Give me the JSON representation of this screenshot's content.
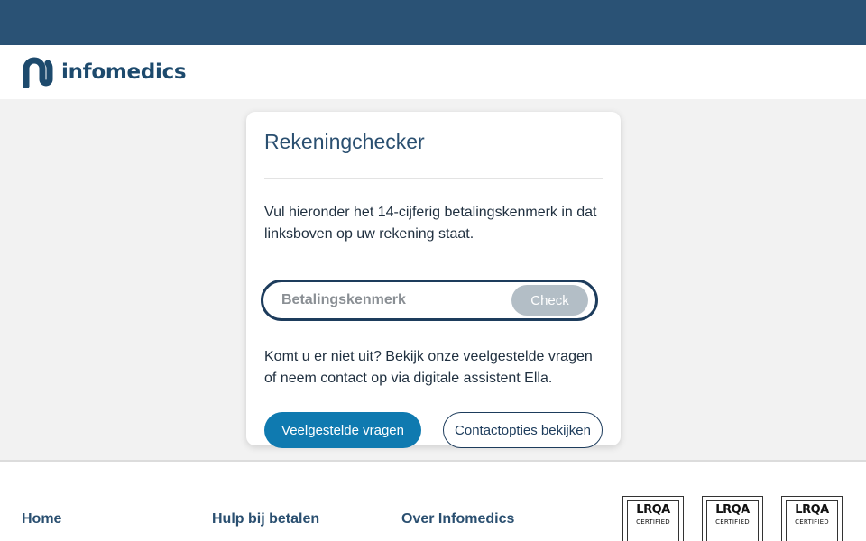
{
  "brand": {
    "name": "infomedics",
    "color": "#1d4a6d"
  },
  "colors": {
    "top_bar": "#2a5275",
    "primary": "#0f7ab0",
    "dark": "#1d3c5c",
    "check_disabled": "#b3bec6"
  },
  "card": {
    "title": "Rekeningchecker",
    "intro": "Vul hieronder het 14-cijferig betalingskenmerk in dat linksboven op uw rekening staat.",
    "search": {
      "placeholder": "Betalingskenmerk",
      "value": "",
      "button_label": "Check"
    },
    "help_text": "Komt u er niet uit? Bekijk onze veelgestelde vragen of neem contact op via digitale assistent Ella.",
    "faq_button": "Veelgestelde vragen",
    "contact_button": "Contactopties bekijken"
  },
  "footer": {
    "links": [
      {
        "label": "Home"
      },
      {
        "label": "Hulp bij betalen"
      },
      {
        "label": "Over Infomedics"
      }
    ],
    "badges": [
      {
        "brand": "LRQA",
        "label": "CERTIFIED"
      },
      {
        "brand": "LRQA",
        "label": "CERTIFIED"
      },
      {
        "brand": "LRQA",
        "label": "CERTIFIED"
      }
    ]
  }
}
